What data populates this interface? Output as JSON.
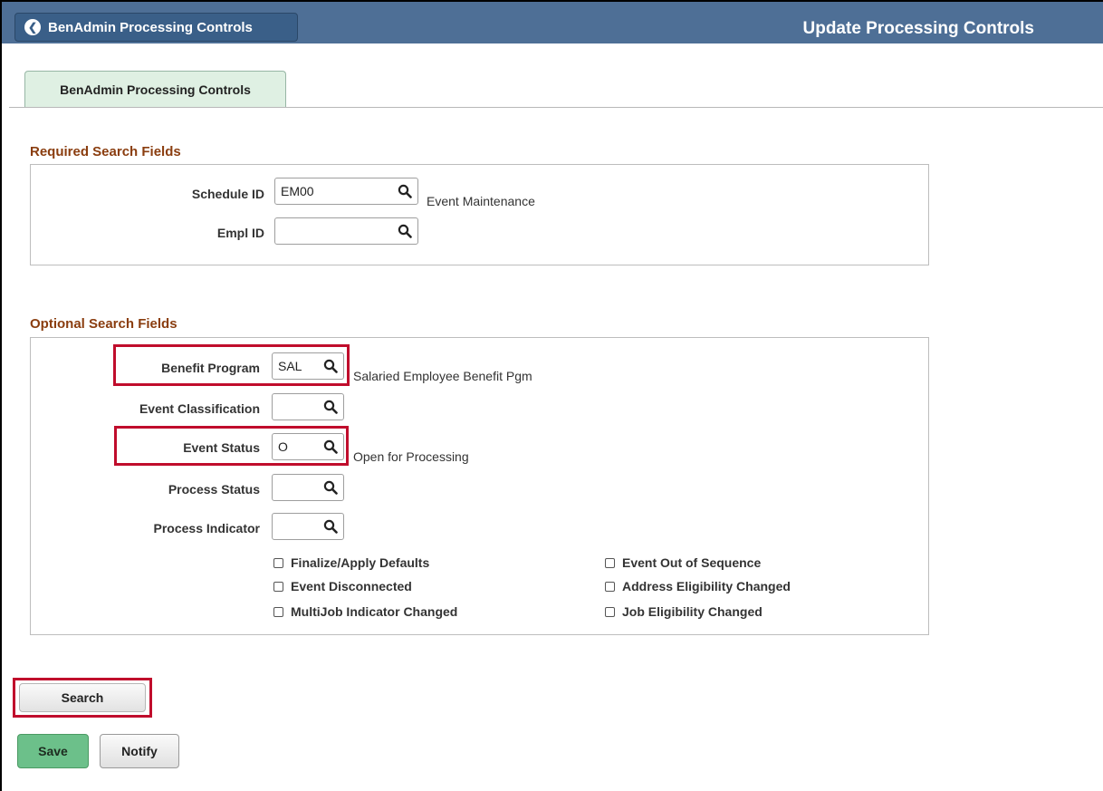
{
  "header": {
    "back_label": "BenAdmin Processing Controls",
    "page_title": "Update Processing Controls",
    "color": "#4e6f96"
  },
  "tab": {
    "label": "BenAdmin Processing Controls"
  },
  "required": {
    "title": "Required Search Fields",
    "schedule_id": {
      "label": "Schedule ID",
      "value": "EM00",
      "description": "Event Maintenance"
    },
    "empl_id": {
      "label": "Empl ID",
      "value": ""
    }
  },
  "optional": {
    "title": "Optional Search Fields",
    "benefit_program": {
      "label": "Benefit Program",
      "value": "SAL",
      "description": "Salaried Employee Benefit Pgm"
    },
    "event_classification": {
      "label": "Event Classification",
      "value": ""
    },
    "event_status": {
      "label": "Event Status",
      "value": "O",
      "description": "Open for Processing"
    },
    "process_status": {
      "label": "Process Status",
      "value": ""
    },
    "process_indicator": {
      "label": "Process Indicator",
      "value": ""
    },
    "checkboxes": [
      {
        "label": "Finalize/Apply Defaults",
        "checked": false
      },
      {
        "label": "Event Out of Sequence",
        "checked": false
      },
      {
        "label": "Event Disconnected",
        "checked": false
      },
      {
        "label": "Address Eligibility Changed",
        "checked": false
      },
      {
        "label": "MultiJob Indicator Changed",
        "checked": false
      },
      {
        "label": "Job Eligibility Changed",
        "checked": false
      }
    ]
  },
  "buttons": {
    "search": "Search",
    "save": "Save",
    "notify": "Notify"
  },
  "colors": {
    "highlight": "#c00d2c",
    "section_title": "#8a3d0f",
    "save_button": "#6cc08a"
  }
}
